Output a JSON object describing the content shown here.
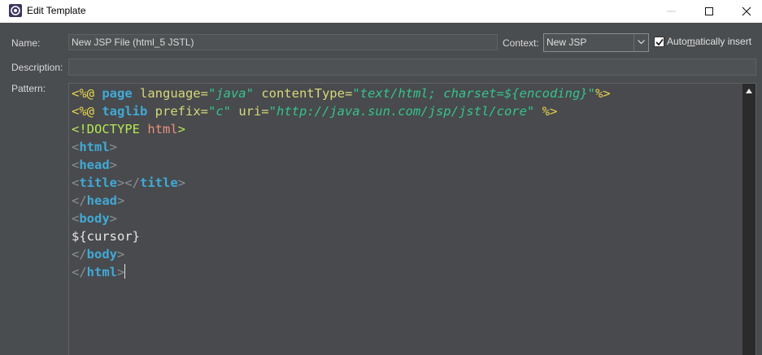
{
  "window": {
    "title": "Edit Template"
  },
  "form": {
    "name_label": "Name:",
    "name_value": "New JSP File (html_5 JSTL)",
    "context_label": "Context:",
    "context_value": "New JSP",
    "auto_insert_before": "Auto",
    "auto_insert_mnemonic": "m",
    "auto_insert_after": "atically insert",
    "auto_insert_checked": true,
    "description_label": "Description:",
    "description_value": "",
    "pattern_label": "Pattern:"
  },
  "pattern_lines": [
    [
      {
        "t": "<%@ ",
        "c": "#e8d44d"
      },
      {
        "t": "page",
        "c": "#41a9d6",
        "b": true
      },
      {
        "t": " language=",
        "c": "#d8d87a"
      },
      {
        "t": "\"java\"",
        "c": "#37c38c",
        "i": true
      },
      {
        "t": " contentType=",
        "c": "#d8d87a"
      },
      {
        "t": "\"",
        "c": "#37c38c"
      },
      {
        "t": "text/html; charset=",
        "c": "#37c38c",
        "i": true
      },
      {
        "t": "${encoding}",
        "c": "#37c38c",
        "i": true
      },
      {
        "t": "\"",
        "c": "#37c38c"
      },
      {
        "t": "%>",
        "c": "#e8d44d"
      }
    ],
    [
      {
        "t": "<%@ ",
        "c": "#e8d44d"
      },
      {
        "t": "taglib",
        "c": "#41a9d6",
        "b": true
      },
      {
        "t": " prefix=",
        "c": "#d8d87a"
      },
      {
        "t": "\"c\"",
        "c": "#37c38c",
        "i": true
      },
      {
        "t": " uri=",
        "c": "#d8d87a"
      },
      {
        "t": "\"http://java.sun.com/jsp/jstl/core\"",
        "c": "#37c38c",
        "i": true
      },
      {
        "t": " %>",
        "c": "#e8d44d"
      }
    ],
    [
      {
        "t": "<!DOCTYPE ",
        "c": "#b5e853"
      },
      {
        "t": "html",
        "c": "#e8927c"
      },
      {
        "t": ">",
        "c": "#b5e853"
      }
    ],
    [
      {
        "t": "<",
        "c": "#8a8f94"
      },
      {
        "t": "html",
        "c": "#41a9d6",
        "b": true
      },
      {
        "t": ">",
        "c": "#8a8f94"
      }
    ],
    [
      {
        "t": "<",
        "c": "#8a8f94"
      },
      {
        "t": "head",
        "c": "#41a9d6",
        "b": true
      },
      {
        "t": ">",
        "c": "#8a8f94"
      }
    ],
    [
      {
        "t": "<",
        "c": "#8a8f94"
      },
      {
        "t": "title",
        "c": "#41a9d6",
        "b": true
      },
      {
        "t": "></",
        "c": "#8a8f94"
      },
      {
        "t": "title",
        "c": "#41a9d6",
        "b": true
      },
      {
        "t": ">",
        "c": "#8a8f94"
      }
    ],
    [
      {
        "t": "</",
        "c": "#8a8f94"
      },
      {
        "t": "head",
        "c": "#41a9d6",
        "b": true
      },
      {
        "t": ">",
        "c": "#8a8f94"
      }
    ],
    [
      {
        "t": "<",
        "c": "#8a8f94"
      },
      {
        "t": "body",
        "c": "#41a9d6",
        "b": true
      },
      {
        "t": ">",
        "c": "#8a8f94"
      }
    ],
    [
      {
        "t": "${cursor}",
        "c": "#e6e6e6"
      }
    ],
    [
      {
        "t": "</",
        "c": "#8a8f94"
      },
      {
        "t": "body",
        "c": "#41a9d6",
        "b": true
      },
      {
        "t": ">",
        "c": "#8a8f94"
      }
    ],
    [
      {
        "t": "</",
        "c": "#8a8f94"
      },
      {
        "t": "html",
        "c": "#41a9d6",
        "b": true
      },
      {
        "t": ">",
        "c": "#8a8f94"
      }
    ]
  ]
}
